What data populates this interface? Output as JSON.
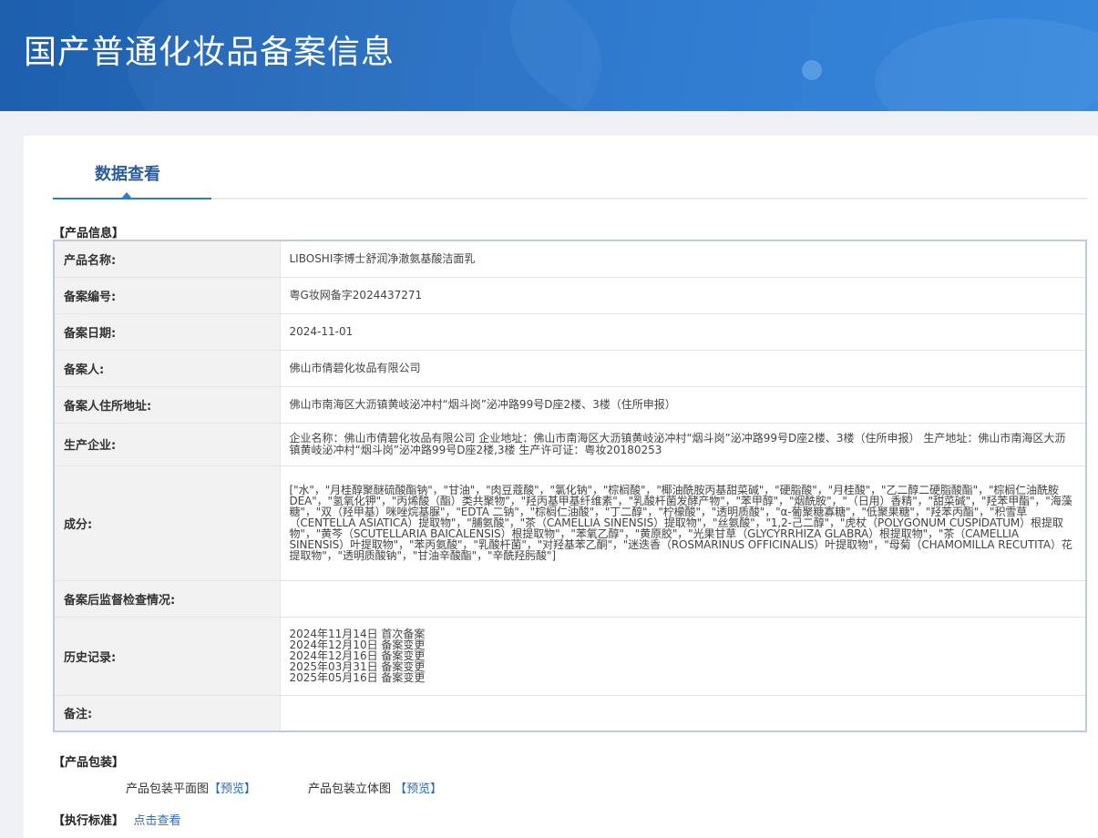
{
  "header": {
    "title": "国产普通化妆品备案信息"
  },
  "tabs": [
    {
      "label": "数据查看",
      "active": true
    }
  ],
  "product_section": {
    "title": "【产品信息】",
    "rows": [
      {
        "key": "产品名称:",
        "value": "LIBOSHI李博士舒润净澈氨基酸洁面乳"
      },
      {
        "key": "备案编号:",
        "value": "粤G妆网备字2024437271"
      },
      {
        "key": "备案日期:",
        "value": "2024-11-01"
      },
      {
        "key": "备案人:",
        "value": "佛山市倩碧化妆品有限公司"
      },
      {
        "key": "备案人住所地址:",
        "value": "佛山市南海区大沥镇黄岐泌冲村“烟斗岗”泌冲路99号D座2楼、3楼（住所申报）"
      },
      {
        "key": "生产企业:",
        "value": "企业名称：佛山市倩碧化妆品有限公司 企业地址：佛山市南海区大沥镇黄岐泌冲村“烟斗岗”泌冲路99号D座2楼、3楼（住所申报） 生产地址：佛山市南海区大沥镇黄岐泌冲村“烟斗岗”泌冲路99号D座2楼,3楼 生产许可证：粤妆20180253"
      },
      {
        "key": "成分:",
        "value": "[\"水\"，\"月桂醇聚醚硫酸酯钠\"，\"甘油\"，\"肉豆蔻酸\"，\"氯化钠\"，\"棕榈酸\"，\"椰油酰胺丙基甜菜碱\"，\"硬脂酸\"，\"月桂酸\"，\"乙二醇二硬脂酸酯\"，\"棕榈仁油酰胺 DEA\"，\"氢氧化钾\"，\"丙烯酸（酯）类共聚物\"，\"羟丙基甲基纤维素\"，\"乳酸杆菌发酵产物\"，\"苯甲醇\"，\"烟酰胺\"，\"（日用）香精\"，\"甜菜碱\"，\"羟苯甲酯\"，\"海藻糖\"，\"双（羟甲基）咪唑烷基脲\"，\"EDTA 二钠\"，\"棕榈仁油酸\"，\"丁二醇\"，\"柠檬酸\"，\"透明质酸\"，\"α-葡聚糖寡糖\"，\"低聚果糖\"，\"羟苯丙酯\"，\"积雪草（CENTELLA ASIATICA）提取物\"，\"脯氨酸\"，\"茶（CAMELLIA SINENSIS）提取物\"，\"丝氨酸\"，\"1,2-己二醇\"，\"虎杖（POLYGONUM CUSPIDATUM）根提取物\"，\"黄芩（SCUTELLARIA BAICALENSIS）根提取物\"，\"苯氧乙醇\"，\"黄原胶\"，\"光果甘草（GLYCYRRHIZA GLABRA）根提取物\"，\"茶（CAMELLIA SINENSIS）叶提取物\"，\"苯丙氨酸\"，\"乳酸杆菌\"，\"对羟基苯乙酮\"，\"迷迭香（ROSMARINUS OFFICINALIS）叶提取物\"，\"母菊（CHAMOMILLA RECUTITA）花提取物\"，\"透明质酸钠\"，\"甘油辛酸酯\"，\"辛酰羟肟酸\"]"
      },
      {
        "key": "备案后监督检查情况:",
        "value": ""
      },
      {
        "key": "历史记录:",
        "value": "2024年11月14日 首次备案\n2024年12月10日 备案变更\n2024年12月16日 备案变更\n2025年03月31日 备案变更\n2025年05月16日 备案变更"
      },
      {
        "key": "备注:",
        "value": ""
      }
    ]
  },
  "packaging_section": {
    "title": "【产品包装】",
    "flat_label": "产品包装平面图",
    "flat_link": "【预览】",
    "three_d_label": "产品包装立体图",
    "three_d_link": "【预览】"
  },
  "standard_section": {
    "title": "【执行标准】",
    "link": "点击查看"
  }
}
